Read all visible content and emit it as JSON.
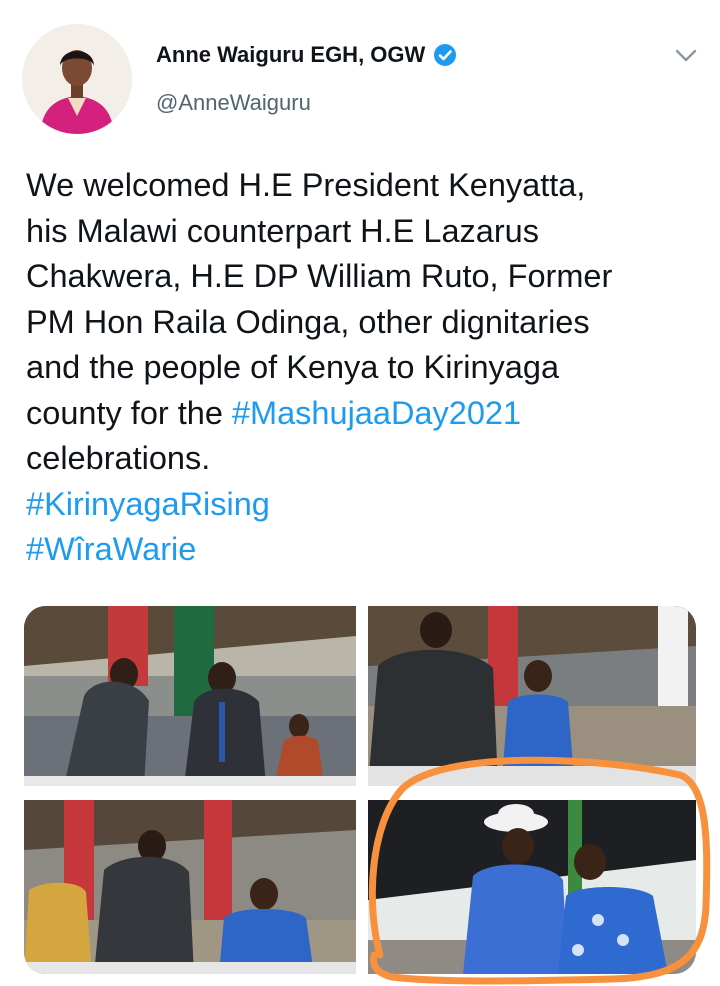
{
  "author": {
    "display_name": "Anne Waiguru EGH, OGW",
    "handle": "@AnneWaiguru"
  },
  "icons": {
    "verified": "verified-badge-icon",
    "menu": "chevron-down-icon"
  },
  "tweet": {
    "lines": [
      {
        "text": "We welcomed H.E President Kenyatta,",
        "link": ""
      },
      {
        "text": "his Malawi counterpart H.E Lazarus",
        "link": ""
      },
      {
        "text": "Chakwera, H.E DP William Ruto, Former",
        "link": ""
      },
      {
        "text": "PM Hon Raila Odinga, other dignitaries",
        "link": ""
      },
      {
        "text": "and the people of Kenya to Kirinyaga",
        "link": ""
      },
      {
        "text": "county for the ",
        "link": "#MashujaaDay2021"
      },
      {
        "text": "celebrations.",
        "link": ""
      }
    ],
    "hashtags": [
      "#KirinyagaRising",
      "#WîraWarie"
    ]
  },
  "colors": {
    "link": "#1d9bf0",
    "text": "#0f1419",
    "secondary": "#536471",
    "verified": "#1d9bf0",
    "annotation": "#f7913d"
  }
}
